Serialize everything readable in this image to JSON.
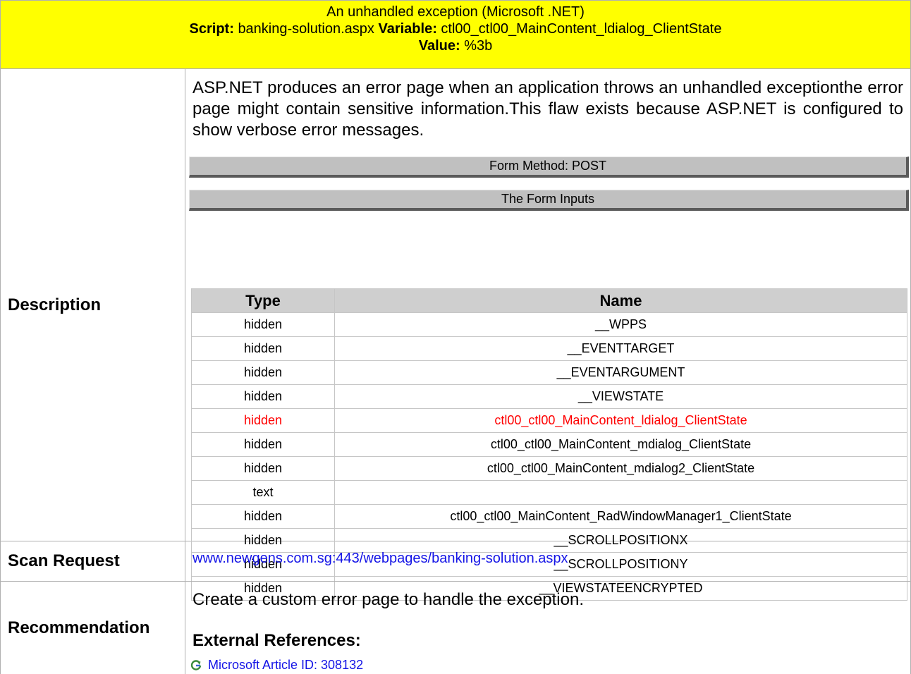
{
  "header": {
    "title": "An unhandled exception (Microsoft .NET)",
    "script_label": "Script:",
    "script_value": "banking-solution.aspx",
    "variable_label": "Variable:",
    "variable_value": "ctl00_ctl00_MainContent_ldialog_ClientState",
    "value_label": "Value:",
    "value_value": "%3b"
  },
  "description": {
    "label": "Description",
    "text": "ASP.NET produces an error page when an application throws an unhandled exceptionthe error page might contain sensitive information.This flaw exists because ASP.NET is configured to show verbose error messages.",
    "form_method": "Form Method: POST",
    "form_inputs_title": "The Form Inputs",
    "columns": [
      "Type",
      "Name"
    ],
    "inputs": [
      {
        "type": "hidden",
        "name": "__WPPS"
      },
      {
        "type": "hidden",
        "name": "__EVENTTARGET"
      },
      {
        "type": "hidden",
        "name": "__EVENTARGUMENT"
      },
      {
        "type": "hidden",
        "name": "__VIEWSTATE"
      },
      {
        "type": "hidden",
        "name": "ctl00_ctl00_MainContent_ldialog_ClientState"
      },
      {
        "type": "hidden",
        "name": "ctl00_ctl00_MainContent_mdialog_ClientState"
      },
      {
        "type": "hidden",
        "name": "ctl00_ctl00_MainContent_mdialog2_ClientState"
      },
      {
        "type": "text",
        "name": ""
      },
      {
        "type": "hidden",
        "name": "ctl00_ctl00_MainContent_RadWindowManager1_ClientState"
      },
      {
        "type": "hidden",
        "name": "__SCROLLPOSITIONX"
      },
      {
        "type": "hidden",
        "name": "__SCROLLPOSITIONY"
      },
      {
        "type": "hidden",
        "name": "__VIEWSTATEENCRYPTED"
      }
    ],
    "highlighted_row_index": 4
  },
  "scan_request": {
    "label": "Scan Request",
    "url": "www.newgens.com.sg:443/webpages/banking-solution.aspx"
  },
  "recommendation": {
    "label": "Recommendation",
    "text": "Create a custom error page to handle the exception.",
    "external_heading": "External References:",
    "references": [
      {
        "label": "Microsoft Article ID: 308132",
        "icon": "refresh-link-icon"
      }
    ]
  },
  "colors": {
    "header_bg": "#ffff00",
    "highlight_text": "#ff0000",
    "link": "#1414e6",
    "bar_bg": "#c0c0c0"
  }
}
